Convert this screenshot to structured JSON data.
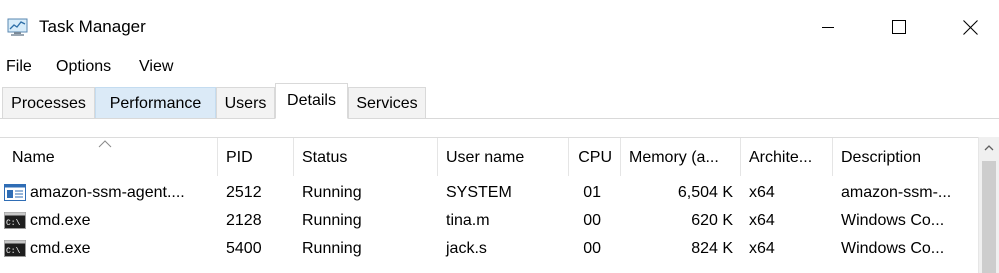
{
  "window": {
    "title": "Task Manager"
  },
  "menu": [
    "File",
    "Options",
    "View"
  ],
  "tabs": [
    {
      "label": "Processes",
      "state": "normal"
    },
    {
      "label": "Performance",
      "state": "hover"
    },
    {
      "label": "Users",
      "state": "normal"
    },
    {
      "label": "Details",
      "state": "active"
    },
    {
      "label": "Services",
      "state": "normal"
    }
  ],
  "table": {
    "sorted_column": "Name",
    "columns": [
      "Name",
      "PID",
      "Status",
      "User name",
      "CPU",
      "Memory (a...",
      "Archite...",
      "Description"
    ],
    "rows": [
      {
        "icon": "service-window-icon",
        "name": "amazon-ssm-agent....",
        "pid": "2512",
        "status": "Running",
        "user": "SYSTEM",
        "cpu": "01",
        "memory": "6,504 K",
        "arch": "x64",
        "description": "amazon-ssm-..."
      },
      {
        "icon": "cmd-console-icon",
        "name": "cmd.exe",
        "pid": "2128",
        "status": "Running",
        "user": "tina.m",
        "cpu": "00",
        "memory": "620 K",
        "arch": "x64",
        "description": "Windows Co..."
      },
      {
        "icon": "cmd-console-icon",
        "name": "cmd.exe",
        "pid": "5400",
        "status": "Running",
        "user": "jack.s",
        "cpu": "00",
        "memory": "824 K",
        "arch": "x64",
        "description": "Windows Co..."
      }
    ]
  },
  "colors": {
    "tab_hover": "#dbeaf7",
    "tab_inactive": "#f3f3f3",
    "scroll_thumb": "#cdcdcd"
  }
}
